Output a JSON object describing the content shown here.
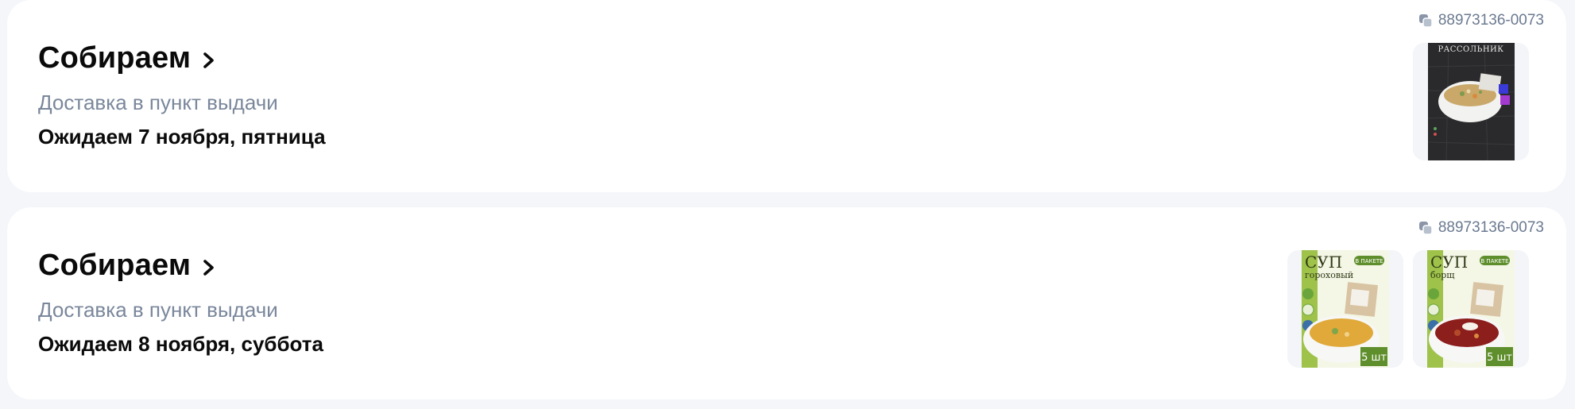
{
  "orders": [
    {
      "order_number": "88973136-0073",
      "status": "Собираем",
      "delivery_type": "Доставка в пункт выдачи",
      "expected": "Ожидаем 7 ноября, пятница",
      "items": [
        {
          "label": "РАССОЛЬНИК",
          "kind": "rassolnik"
        }
      ]
    },
    {
      "order_number": "88973136-0073",
      "status": "Собираем",
      "delivery_type": "Доставка в пункт выдачи",
      "expected": "Ожидаем 8 ноября, суббота",
      "items": [
        {
          "label": "СУП",
          "label2": "гороховый",
          "badge": "В ПАКЕТЕ",
          "count": "5 шт",
          "kind": "pea-soup"
        },
        {
          "label": "СУП",
          "label2": "борщ",
          "badge": "В ПАКЕТЕ",
          "count": "5 шт",
          "kind": "borscht"
        }
      ]
    }
  ],
  "colors": {
    "page_bg": "#f4f6fa",
    "card_bg": "#ffffff",
    "muted_text": "#7a879b",
    "order_number_text": "#6b7a90"
  },
  "icons": {
    "copy": "copy-icon",
    "chevron": "chevron-right-icon"
  }
}
